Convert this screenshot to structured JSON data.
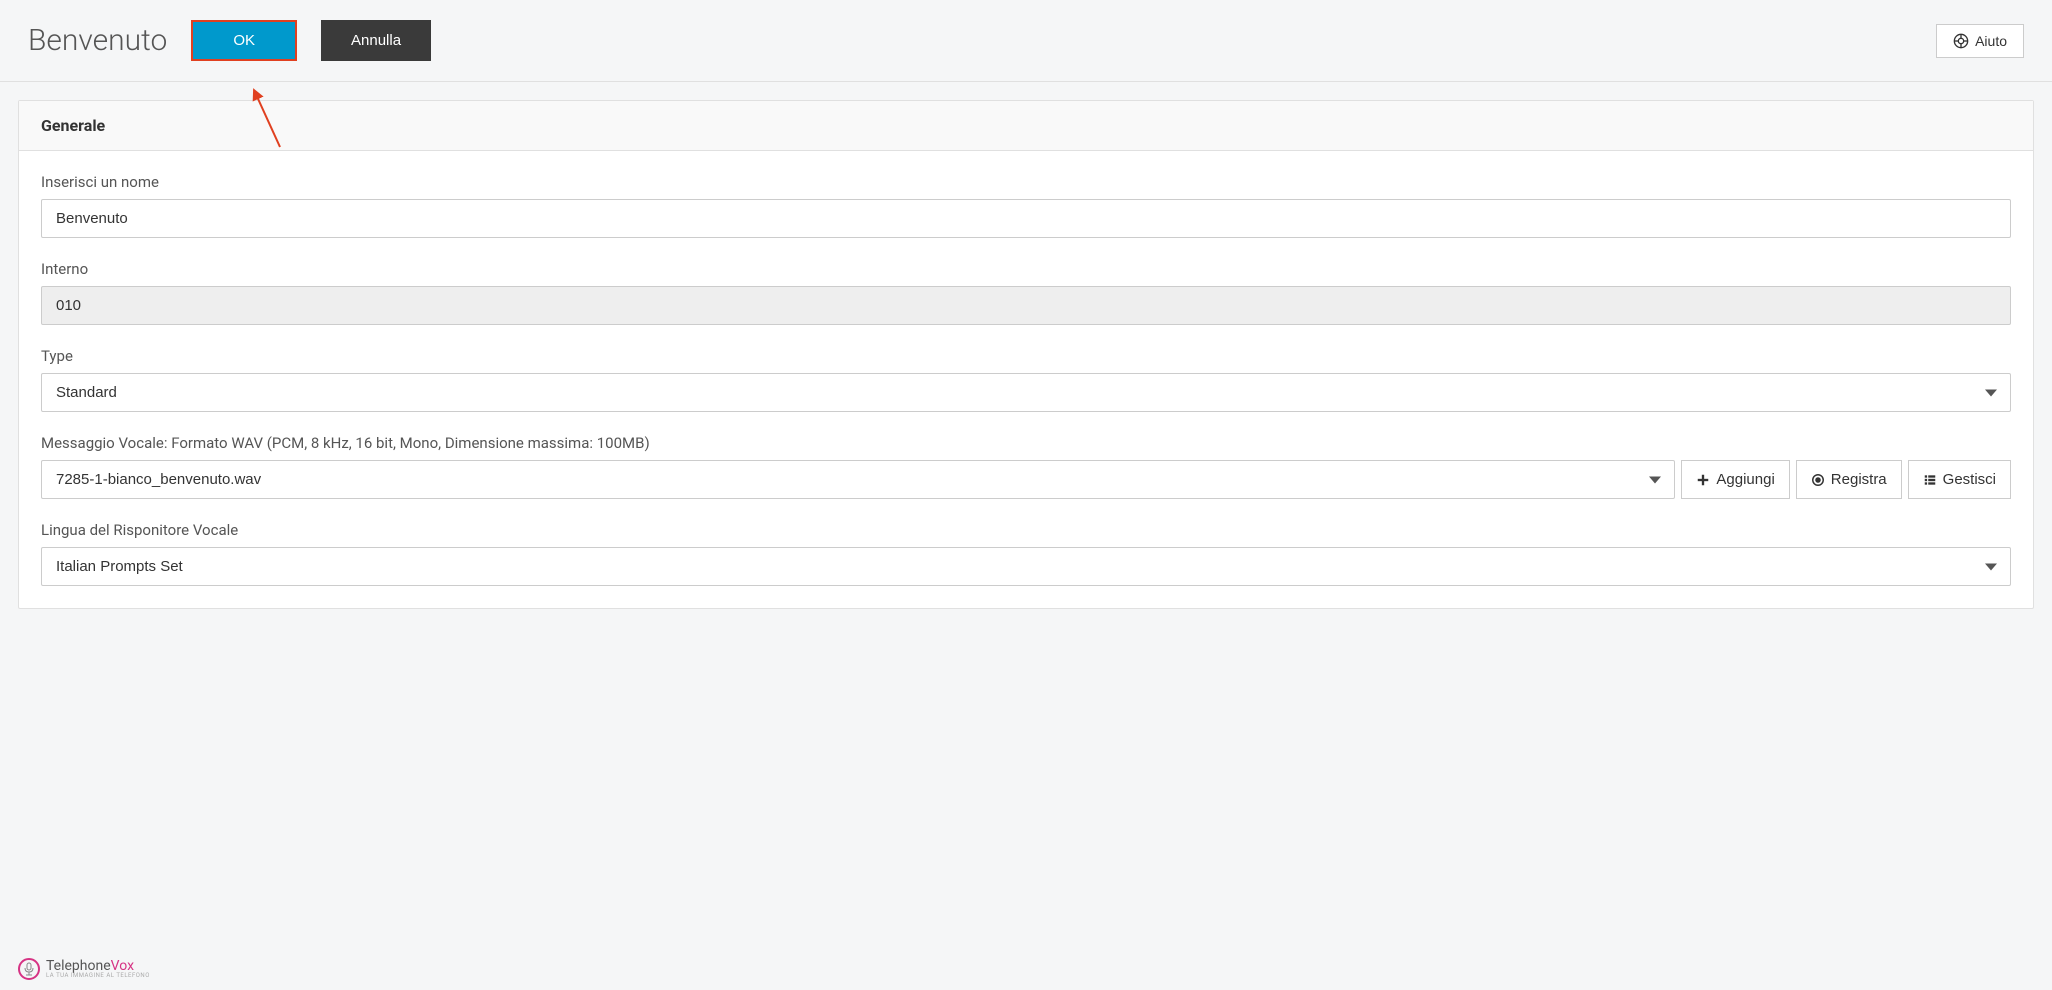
{
  "header": {
    "title": "Benvenuto",
    "ok_label": "OK",
    "cancel_label": "Annulla",
    "help_label": "Aiuto"
  },
  "panel": {
    "title": "Generale"
  },
  "form": {
    "name": {
      "label": "Inserisci un nome",
      "value": "Benvenuto"
    },
    "interno": {
      "label": "Interno",
      "value": "010"
    },
    "type": {
      "label": "Type",
      "value": "Standard"
    },
    "voice_message": {
      "label": "Messaggio Vocale: Formato WAV (PCM, 8 kHz, 16 bit, Mono, Dimensione massima: 100MB)",
      "value": "7285-1-bianco_benvenuto.wav",
      "add_label": "Aggiungi",
      "record_label": "Registra",
      "manage_label": "Gestisci"
    },
    "language": {
      "label": "Lingua del Risponitore Vocale",
      "value": "Italian Prompts Set"
    }
  },
  "logo": {
    "brand_prefix": "Telephone",
    "brand_suffix": "Vox",
    "tagline": "LA TUA IMMAGINE AL TELEFONO"
  }
}
